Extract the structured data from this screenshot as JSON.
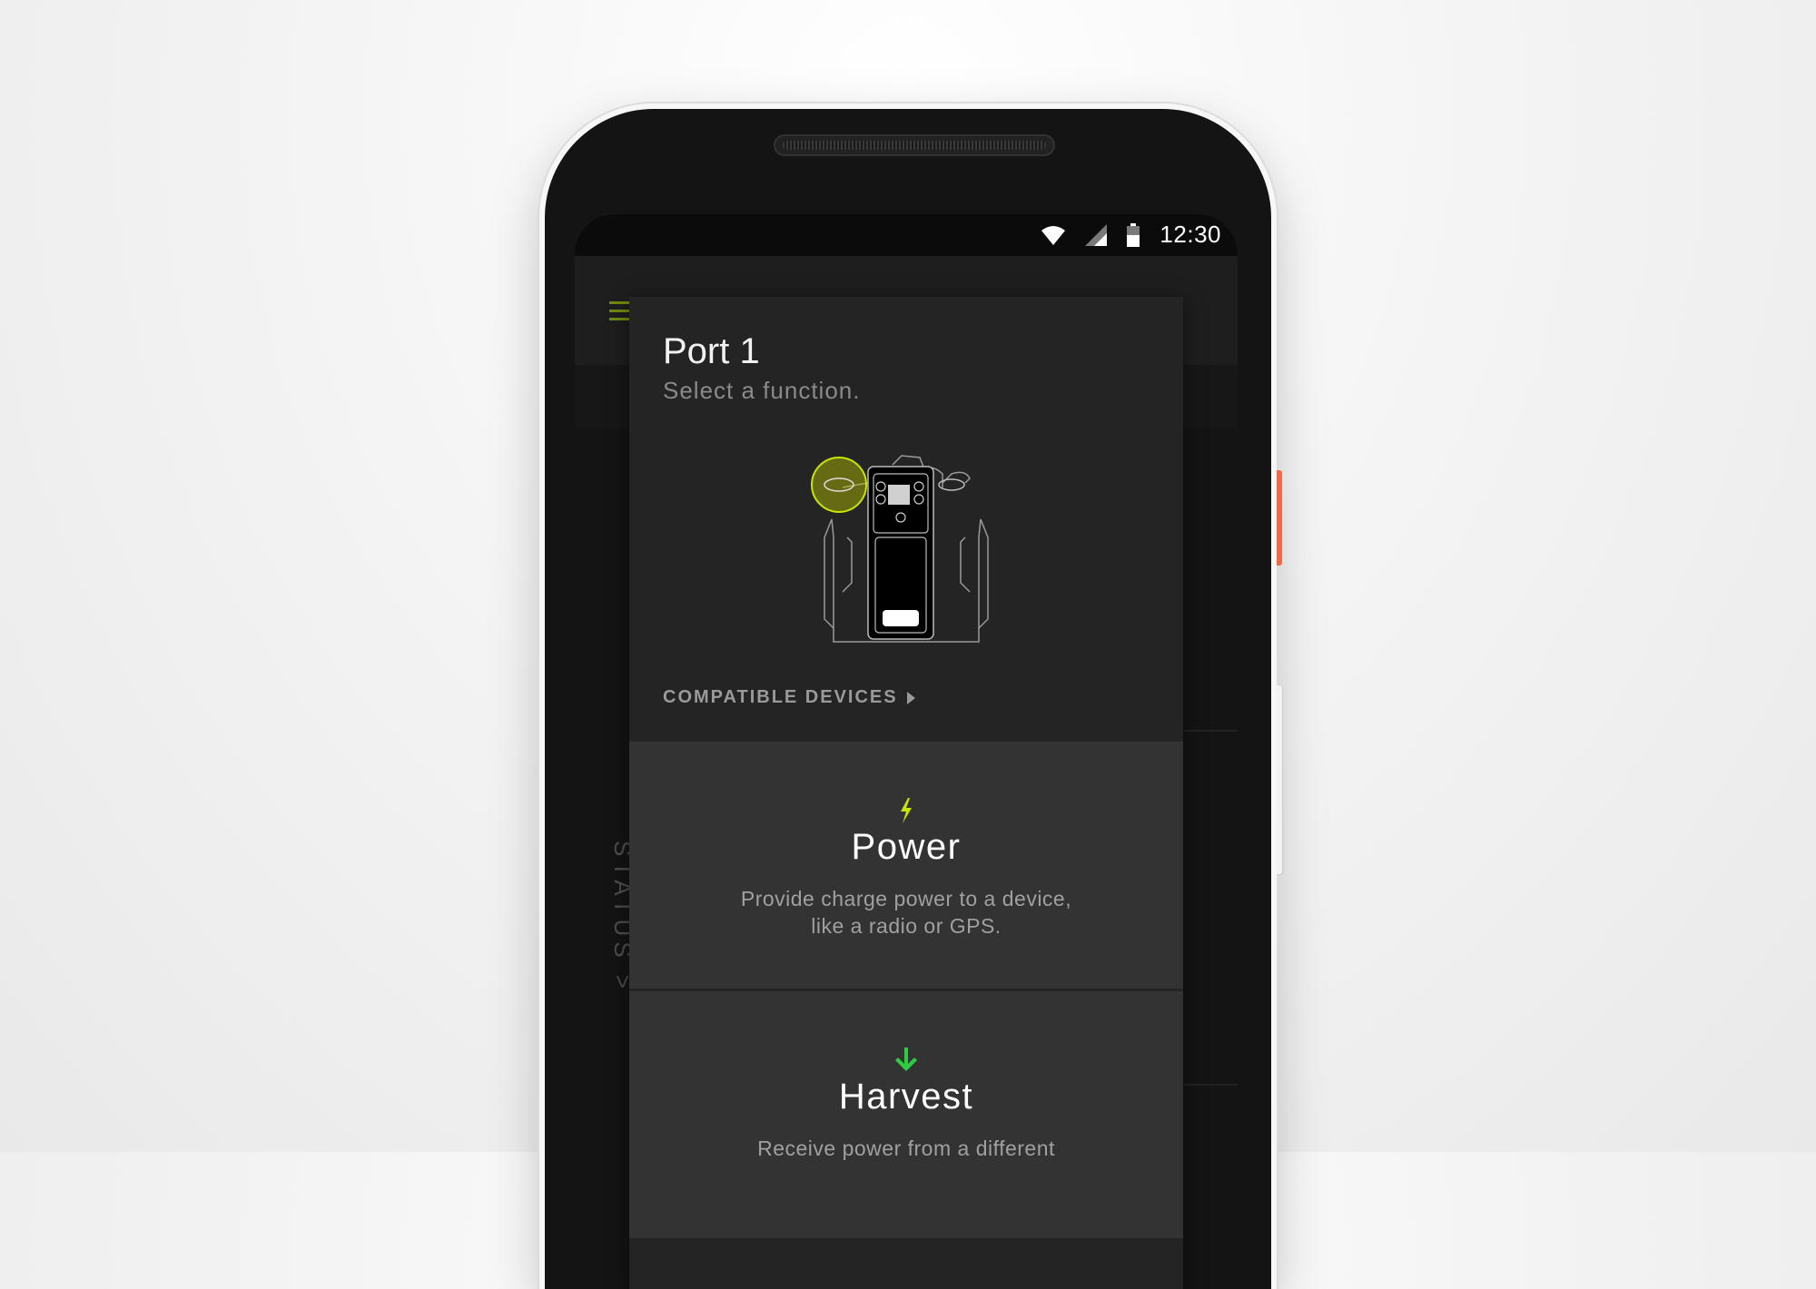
{
  "status_bar": {
    "time": "12:30"
  },
  "background": {
    "status_label": "STATUS >"
  },
  "dialog": {
    "title": "Port 1",
    "subtitle": "Select a function.",
    "compatible_devices_label": "COMPATIBLE DEVICES"
  },
  "options": [
    {
      "title": "Power",
      "description_line1": "Provide charge power to a device,",
      "description_line2": "like a radio or GPS.",
      "icon": "lightning-icon",
      "icon_color": "#c8e600"
    },
    {
      "title": "Harvest",
      "description_line1": "Receive power from a different",
      "icon": "arrow-down-icon",
      "icon_color": "#2ecc40"
    }
  ],
  "colors": {
    "highlight": "#c8e600",
    "accent_button": "#f06a45"
  }
}
